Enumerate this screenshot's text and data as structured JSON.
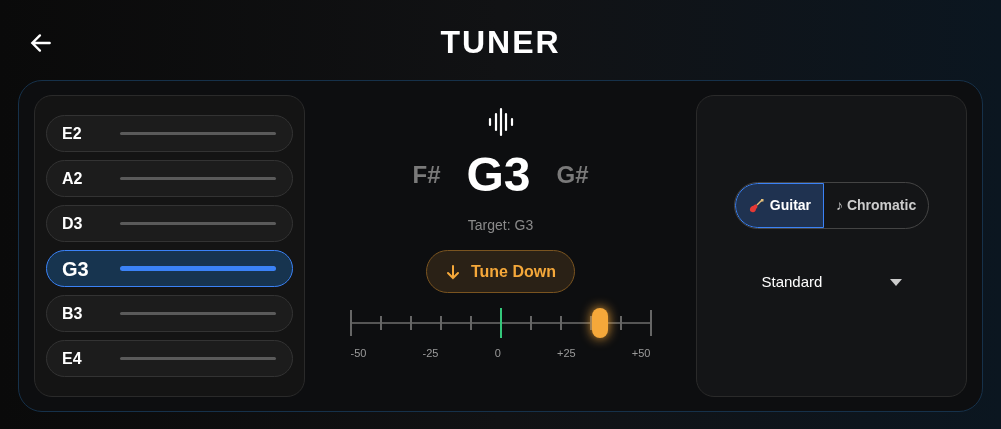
{
  "header": {
    "title": "TUNER"
  },
  "strings": [
    {
      "label": "E2",
      "selected": false
    },
    {
      "label": "A2",
      "selected": false
    },
    {
      "label": "D3",
      "selected": false
    },
    {
      "label": "G3",
      "selected": true
    },
    {
      "label": "B3",
      "selected": false
    },
    {
      "label": "E4",
      "selected": false
    }
  ],
  "display": {
    "flat_neighbor": "F#",
    "note": "G3",
    "sharp_neighbor": "G#",
    "target": "Target: G3",
    "hint": "Tune Down"
  },
  "meter": {
    "level": 0.83,
    "labels": [
      "-50",
      "-25",
      "0",
      "+25",
      "+50"
    ]
  },
  "modes": [
    {
      "label": "Guitar",
      "kind": "guitar",
      "selected": true
    },
    {
      "label": "♪ Chromatic",
      "kind": "plain",
      "selected": false
    }
  ],
  "tuning": {
    "value": "Standard"
  }
}
